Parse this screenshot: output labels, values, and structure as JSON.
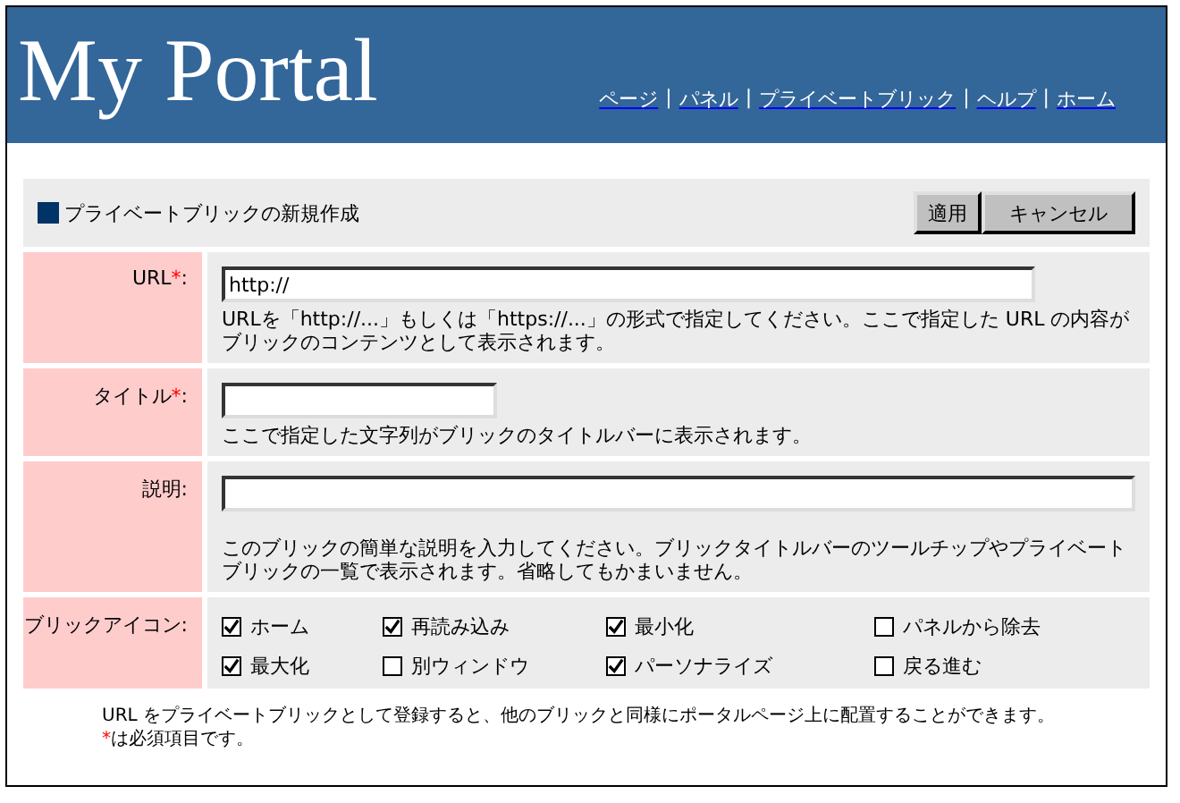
{
  "header": {
    "title": "My Portal",
    "nav": [
      {
        "label": "ページ"
      },
      {
        "label": "パネル"
      },
      {
        "label": "プライベートブリック"
      },
      {
        "label": "ヘルプ"
      },
      {
        "label": "ホーム"
      }
    ],
    "separator": "|"
  },
  "section": {
    "title": "プライベートブリックの新規作成",
    "buttons": [
      "適用",
      "キャンセル"
    ]
  },
  "fields": [
    {
      "kind": "url",
      "label": "URL",
      "required_mark": "*",
      "suffix": ":",
      "value": "http://",
      "help": "URLを「http://...」もしくは「https://...」の形式で指定してください。ここで指定した URL の内容がブリックのコンテンツとして表示されます。"
    },
    {
      "kind": "title",
      "label": "タイトル",
      "required_mark": "*",
      "suffix": ":",
      "help": "ここで指定した文字列がブリックのタイトルバーに表示されます。"
    },
    {
      "kind": "description",
      "label": "説明",
      "suffix": ":",
      "help": "このブリックの簡単な説明を入力してください。ブリックタイトルバーのツールチップやプライベートブリックの一覧で表示されます。省略してもかまいません。"
    },
    {
      "kind": "checkboxes",
      "label": "ブリックアイコン",
      "suffix": ":",
      "options": [
        {
          "label": "ホーム",
          "checked": true
        },
        {
          "label": "再読み込み",
          "checked": true
        },
        {
          "label": "最小化",
          "checked": true
        },
        {
          "label": "パネルから除去",
          "checked": false
        },
        {
          "label": "最大化",
          "checked": true
        },
        {
          "label": "別ウィンドウ",
          "checked": false
        },
        {
          "label": "パーソナライズ",
          "checked": true
        },
        {
          "label": "戻る進む",
          "checked": false
        }
      ]
    }
  ],
  "footer": {
    "note": "URL をプライベートブリックとして登録すると、他のブリックと同様にポータルページ上に配置することができます。",
    "required_mark": "*",
    "required_note": "は必須項目です。"
  }
}
